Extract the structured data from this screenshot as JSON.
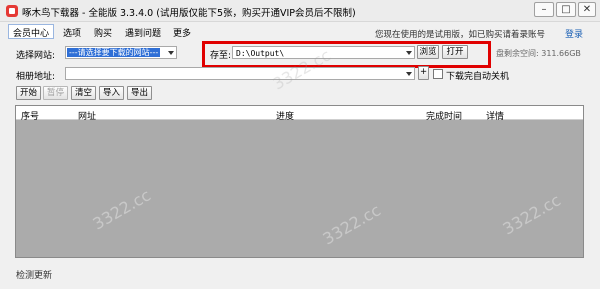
{
  "window": {
    "title": "啄木鸟下载器 - 全能版 3.3.4.0 (试用版仅能下5张，购买开通VIP会员后不限制)"
  },
  "menu": {
    "items": [
      "会员中心",
      "选项",
      "购买",
      "遇到问题",
      "更多"
    ]
  },
  "trial": {
    "notice": "您现在使用的是试用版，如已购买请着录账号",
    "login": "登录"
  },
  "site": {
    "label": "选择网站:",
    "value": "---请选择要下载的网站---"
  },
  "save": {
    "label": "存至:",
    "path": "D:\\Output\\",
    "browse": "浏览",
    "open": "打开",
    "disk_space": "盘剩余空间: 311.66GB"
  },
  "album": {
    "label": "相册地址:",
    "value": "",
    "add": "+"
  },
  "shutdown": {
    "label": "下载完自动关机"
  },
  "toolbar": {
    "start": "开始",
    "pause": "暂停",
    "clear": "清空",
    "import": "导入",
    "export": "导出"
  },
  "table": {
    "columns": [
      "序号",
      "网址",
      "进度",
      "完成时间",
      "详情"
    ]
  },
  "status": {
    "text": "检测更新"
  },
  "watermark": {
    "text": "3322.cc"
  }
}
